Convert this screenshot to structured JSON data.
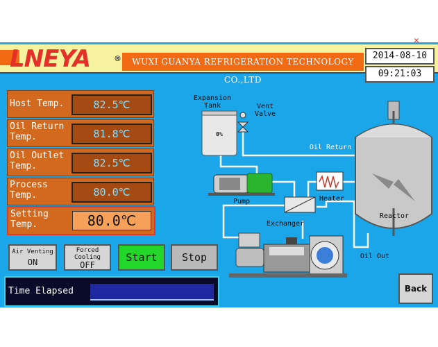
{
  "header": {
    "logo_text": "LNEYA",
    "logo_mark": "®",
    "company": "WUXI GUANYA REFRIGERATION TECHNOLOGY CO.,LTD",
    "date": "2014-08-10",
    "time": "09:21:03",
    "close_glyph": "✕"
  },
  "readings": [
    {
      "label": "Host Temp.",
      "value": "82.5℃"
    },
    {
      "label": "Oil Return\nTemp.",
      "value": "81.8℃"
    },
    {
      "label": "Oil Outlet\nTemp.",
      "value": "82.5℃"
    },
    {
      "label": "Process\nTemp.",
      "value": "80.0℃"
    },
    {
      "label": "Setting\nTemp.",
      "value": "80.0℃"
    }
  ],
  "controls": {
    "air_venting_label": "Air Venting",
    "air_venting_state": "ON",
    "forced_cooling_label": "Forced\nCooling",
    "forced_cooling_state": "OFF",
    "start": "Start",
    "stop": "Stop",
    "back": "Back"
  },
  "elapsed": {
    "label": "Time Elapsed"
  },
  "diagram": {
    "expansion_tank": "Expansion\nTank",
    "tank_level": "0%",
    "vent_valve": "Vent\nValve",
    "oil_return": "Oil Return",
    "pump": "Pump",
    "heater": "Heater",
    "exchanger": "Exchanger",
    "reactor": "Reactor",
    "oil_out": "Oil Out"
  },
  "colors": {
    "panel": "#1aa6e8",
    "accent": "#f26b14",
    "start": "#22d62a"
  }
}
